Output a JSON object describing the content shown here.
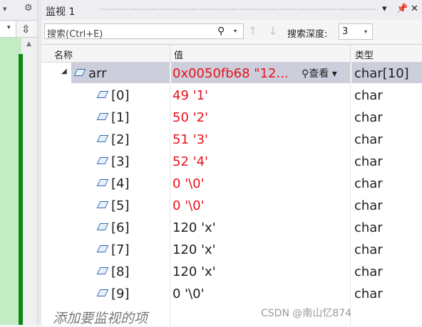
{
  "window": {
    "title": "监视 1"
  },
  "search": {
    "placeholder": "搜索(Ctrl+E)"
  },
  "depth": {
    "label": "搜索深度:",
    "value": "3"
  },
  "columns": {
    "name": "名称",
    "value": "值",
    "type": "类型"
  },
  "parent": {
    "name": "arr",
    "value": "0x0050fb68 \"12...",
    "view_label": "查看",
    "type": "char[10]"
  },
  "rows": [
    {
      "name": "[0]",
      "value": "49 '1'",
      "type": "char",
      "changed": true
    },
    {
      "name": "[1]",
      "value": "50 '2'",
      "type": "char",
      "changed": true
    },
    {
      "name": "[2]",
      "value": "51 '3'",
      "type": "char",
      "changed": true
    },
    {
      "name": "[3]",
      "value": "52 '4'",
      "type": "char",
      "changed": true
    },
    {
      "name": "[4]",
      "value": "0 '\\0'",
      "type": "char",
      "changed": true
    },
    {
      "name": "[5]",
      "value": "0 '\\0'",
      "type": "char",
      "changed": true
    },
    {
      "name": "[6]",
      "value": "120 'x'",
      "type": "char",
      "changed": false
    },
    {
      "name": "[7]",
      "value": "120 'x'",
      "type": "char",
      "changed": false
    },
    {
      "name": "[8]",
      "value": "120 'x'",
      "type": "char",
      "changed": false
    },
    {
      "name": "[9]",
      "value": "0 '\\0'",
      "type": "char",
      "changed": false
    }
  ],
  "add_hint": "添加要监视的项",
  "watermark": "CSDN @南山忆874",
  "colors": {
    "changed_value": "#e8111b",
    "selection": "#cccedb",
    "breakpoint_bar": "#118811"
  }
}
